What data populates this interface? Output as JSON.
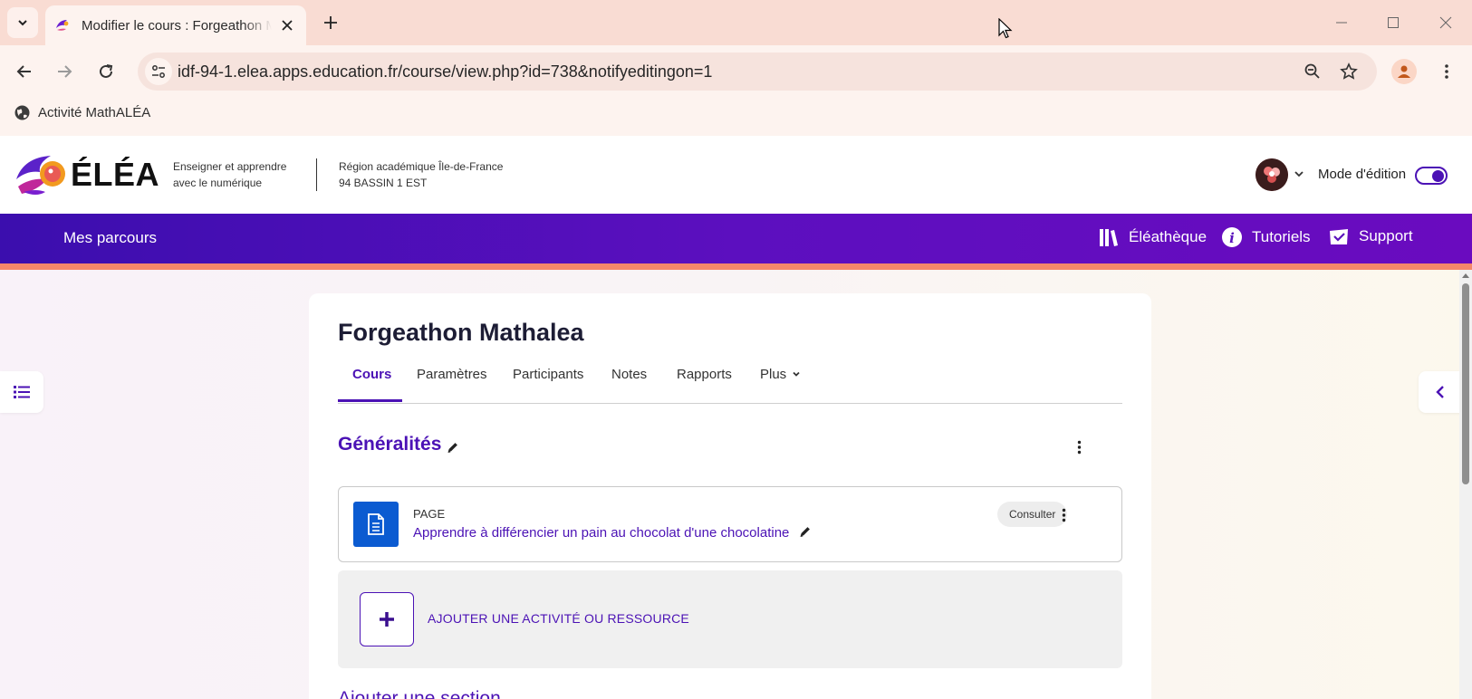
{
  "browser": {
    "tab_title": "Modifier le cours : Forgeathon Mathalea",
    "url": "idf-94-1.elea.apps.education.fr/course/view.php?id=738&notifyeditingon=1",
    "bookmark_label": "Activité MathALÉA"
  },
  "header": {
    "logo_text": "ÉLÉA",
    "tagline_line1": "Enseigner et apprendre",
    "tagline_line2": "avec le numérique",
    "region_line1": "Région académique Île-de-France",
    "region_line2": "94 BASSIN 1 EST",
    "edit_mode_label": "Mode d'édition",
    "edit_mode_on": true
  },
  "nav": {
    "mes_parcours": "Mes parcours",
    "eleatheque": "Éléathèque",
    "tutoriels": "Tutoriels",
    "support": "Support"
  },
  "course": {
    "title": "Forgeathon Mathalea",
    "tabs": [
      "Cours",
      "Paramètres",
      "Participants",
      "Notes",
      "Rapports",
      "Plus"
    ],
    "active_tab": "Cours"
  },
  "section": {
    "title": "Généralités",
    "activity": {
      "type": "PAGE",
      "name": "Apprendre à différencier un pain au chocolat d'une chocolatine",
      "button": "Consulter"
    },
    "add_activity_label": "AJOUTER UNE ACTIVITÉ OU RESSOURCE",
    "add_section_label": "Ajouter une section"
  },
  "colors": {
    "accent": "#4b12b5",
    "nav_gradient_start": "#3b0eae",
    "nav_gradient_end": "#6a0bbf",
    "orange_strip": "#f5876a",
    "activity_icon_bg": "#0b5bd1"
  }
}
